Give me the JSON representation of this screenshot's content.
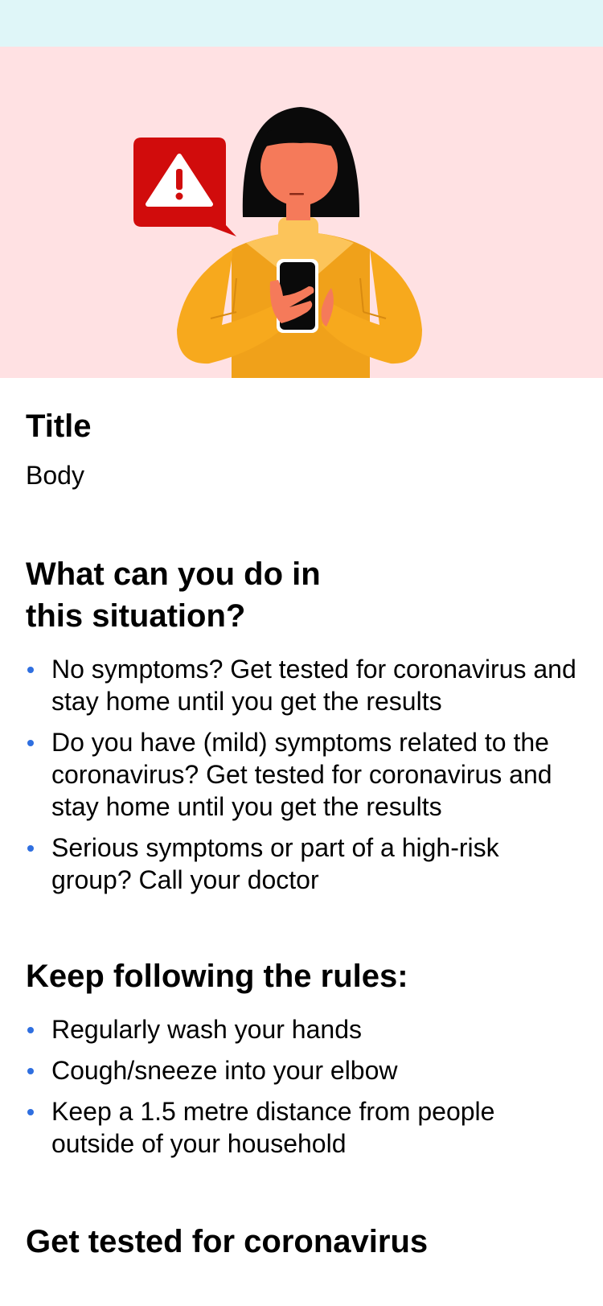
{
  "colors": {
    "status_bar": "#dff6f8",
    "hero_background": "#ffe1e3",
    "bullet": "#2f6fe0",
    "alert_red": "#d10c0c",
    "sweater": "#f7a91d"
  },
  "hero": {
    "icons": [
      "warning-icon",
      "person-holding-phone-illustration"
    ]
  },
  "content": {
    "title": "Title",
    "body": "Body"
  },
  "sections": [
    {
      "heading": "What can you do in this situation?",
      "items": [
        "No symptoms? Get tested for coronavirus and stay home until you get the results",
        "Do you have (mild) symptoms related to the coronavirus? Get tested for coronavirus and stay home until you get the results",
        "Serious symptoms or part of a high-risk group? Call your doctor"
      ]
    },
    {
      "heading": "Keep following the rules:",
      "items": [
        "Regularly wash your hands",
        "Cough/sneeze into your elbow",
        "Keep a 1.5 metre distance from people outside of your household"
      ]
    },
    {
      "heading": "Get tested for coronavirus"
    }
  ]
}
